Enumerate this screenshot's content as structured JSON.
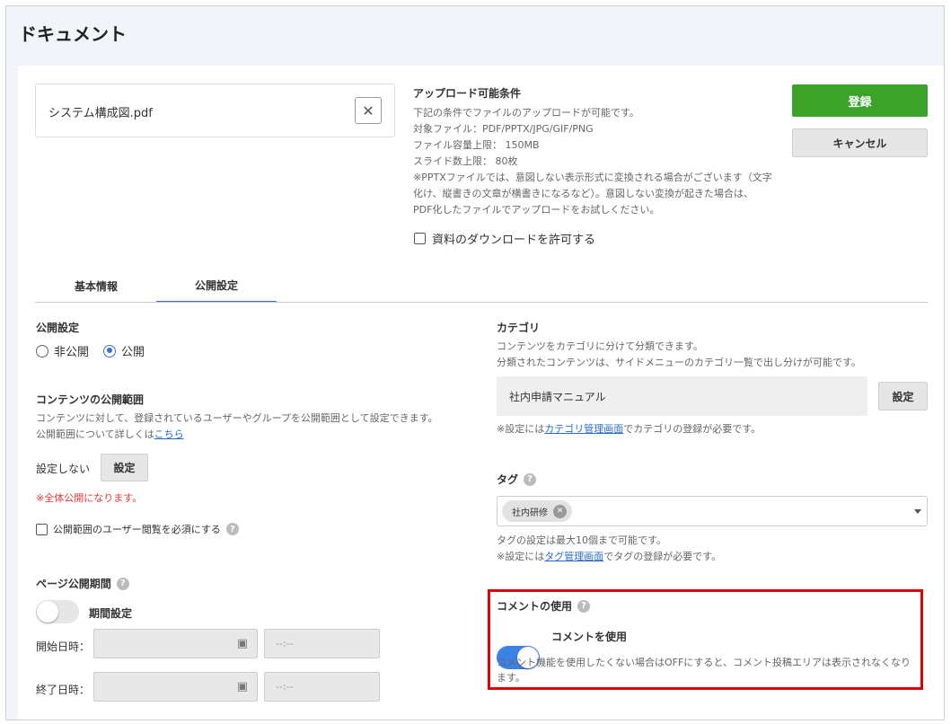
{
  "page": {
    "title": "ドキュメント"
  },
  "upload": {
    "file_name": "システム構成図.pdf",
    "conditions_title": "アップロード可能条件",
    "conditions": [
      "下記の条件でファイルのアップロードが可能です。",
      "対象ファイル：PDF/PPTX/JPG/GIF/PNG",
      "ファイル容量上限： 150MB",
      "スライド数上限： 80枚",
      "※PPTXファイルでは、意図しない表示形式に変換される場合がございます（文字",
      "化け、縦書きの文章が横書きになるなど）。意図しない変換が起きた場合は、",
      "PDF化したファイルでアップロードをお試しください。"
    ],
    "download_checkbox_label": "資料のダウンロードを許可する"
  },
  "actions": {
    "register_label": "登録",
    "cancel_label": "キャンセル"
  },
  "tabs": [
    {
      "label": "基本情報",
      "active": false
    },
    {
      "label": "公開設定",
      "active": true
    }
  ],
  "publish": {
    "title": "公開設定",
    "option_private": "非公開",
    "option_public": "公開",
    "selected": "公開"
  },
  "scope": {
    "title": "コンテンツの公開範囲",
    "desc1": "コンテンツに対して、登録されているユーザーやグループを公開範囲として設定できます。",
    "desc2": "公開範囲について詳しくは",
    "link": "こちら",
    "status": "設定しない",
    "button": "設定",
    "warning": "※全体公開になります。",
    "require_view_label": "公開範囲のユーザー閲覧を必須にする"
  },
  "period": {
    "title": "ページ公開期間",
    "toggle_label": "期間設定",
    "toggle_on": false,
    "start_label": "開始日時：",
    "end_label": "終了日時：",
    "time_placeholder": "--:--"
  },
  "category": {
    "title": "カテゴリ",
    "desc1": "コンテンツをカテゴリに分けて分類できます。",
    "desc2": "分類されたコンテンツは、サイドメニューのカテゴリ一覧で出し分けが可能です。",
    "value": "社内申請マニュアル",
    "button": "設定",
    "note_prefix": "※設定には",
    "note_link": "カテゴリ管理画面",
    "note_suffix": "でカテゴリの登録が必要です。"
  },
  "tag": {
    "title": "タグ",
    "chips": [
      "社内研修"
    ],
    "note1": "タグの設定は最大10個まで可能です。",
    "note_prefix": "※設定には",
    "note_link": "タグ管理画面",
    "note_suffix": "でタグの登録が必要です。"
  },
  "comment": {
    "title": "コメントの使用",
    "toggle_label": "コメントを使用",
    "toggle_on": true,
    "desc": "コメント機能を使用したくない場合はOFFにすると、コメント投稿エリアは表示されなくなります。"
  },
  "colors": {
    "primary": "#3ba32a",
    "accent": "#3b82e6",
    "warning": "#e53935",
    "highlight": "#e00000"
  }
}
